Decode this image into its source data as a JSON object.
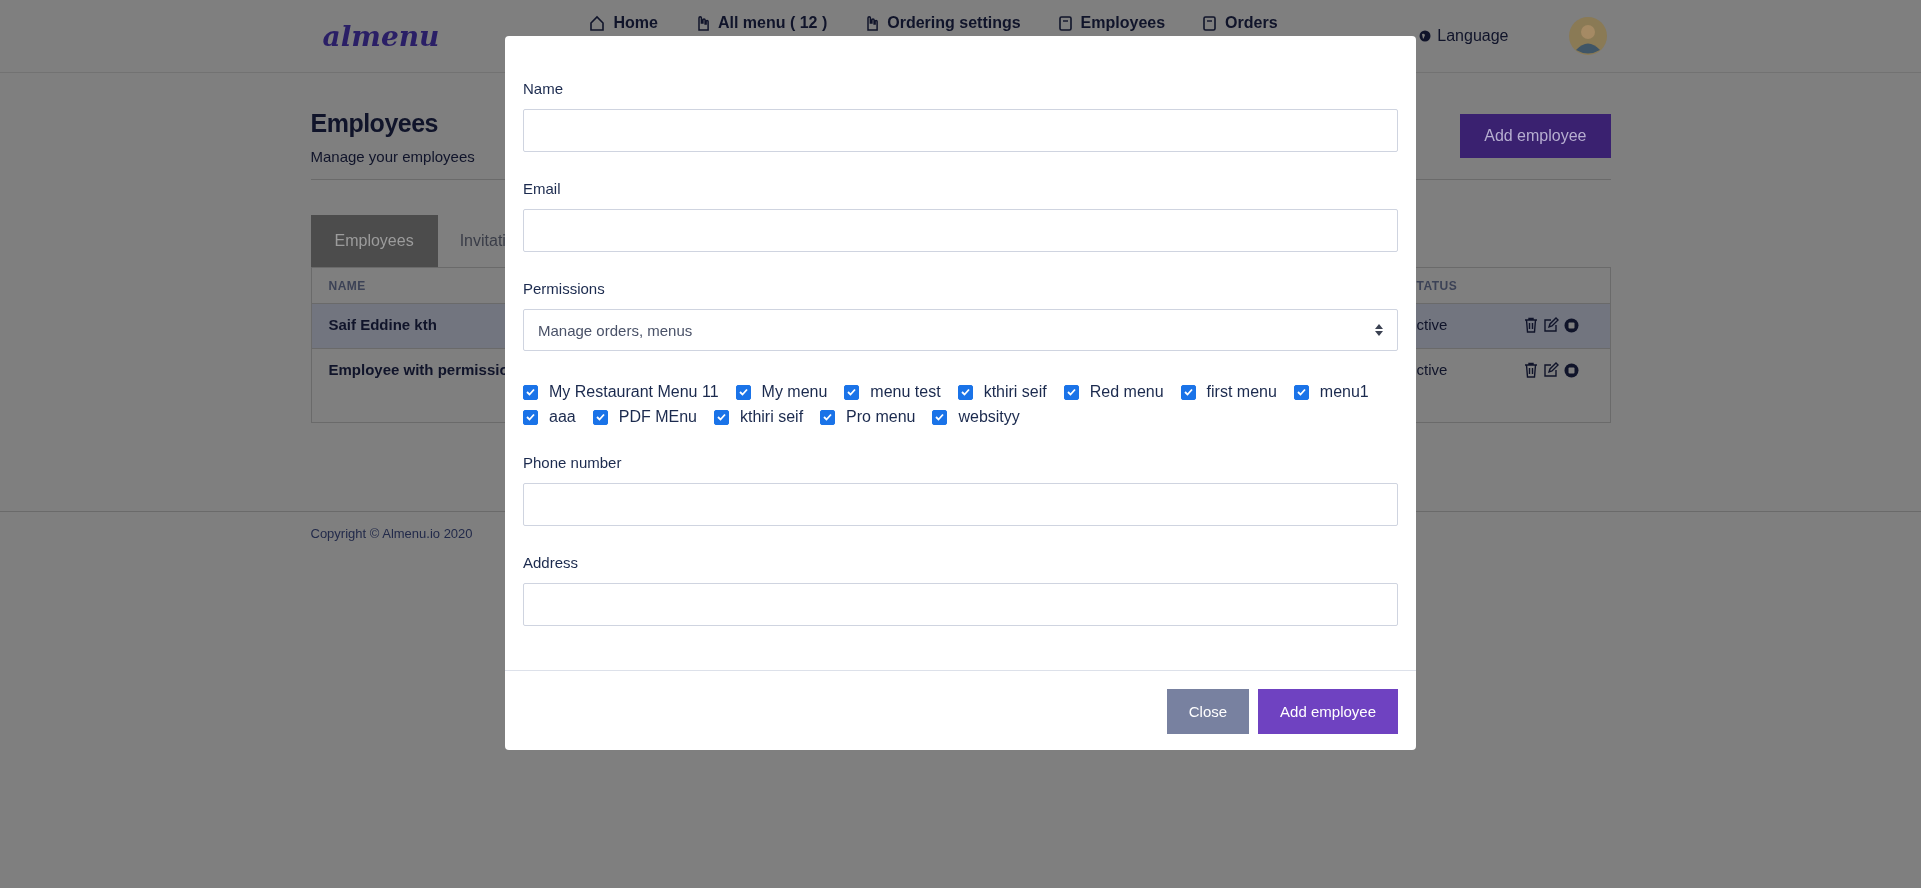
{
  "header": {
    "logo": "almenu",
    "nav": [
      {
        "label": "Home"
      },
      {
        "label": "All menu ( 12 )"
      },
      {
        "label": "Ordering settings"
      },
      {
        "label": "Employees"
      },
      {
        "label": "Orders"
      }
    ],
    "language": "Language"
  },
  "page": {
    "title": "Employees",
    "subtitle": "Manage your employees",
    "add_button": "Add employee"
  },
  "tabs": [
    {
      "label": "Employees",
      "selected": true
    },
    {
      "label": "Invitati",
      "selected": false
    }
  ],
  "table": {
    "columns": [
      "NAME",
      "TATUS"
    ],
    "rows": [
      {
        "name": "Saif Eddine kth",
        "status": "ctive",
        "highlighted": true
      },
      {
        "name": "Employee with permissio",
        "status": "ctive",
        "highlighted": false
      }
    ]
  },
  "footer": {
    "copyright": "Copyright © Almenu.io 2020"
  },
  "modal": {
    "fields": [
      {
        "kind": "input",
        "label": "Name"
      },
      {
        "kind": "input",
        "label": "Email"
      },
      {
        "kind": "select",
        "label": "Permissions",
        "value": "Manage orders, menus"
      },
      {
        "kind": "checks",
        "options": [
          {
            "label": "My Restaurant Menu 11",
            "checked": true
          },
          {
            "label": "My menu",
            "checked": true
          },
          {
            "label": "menu test",
            "checked": true
          },
          {
            "label": "kthiri seif",
            "checked": true
          },
          {
            "label": "Red menu",
            "checked": true
          },
          {
            "label": "first menu",
            "checked": true
          },
          {
            "label": "menu1",
            "checked": true
          },
          {
            "label": "aaa",
            "checked": true
          },
          {
            "label": "PDF MEnu",
            "checked": true
          },
          {
            "label": "kthiri seif",
            "checked": true
          },
          {
            "label": "Pro menu",
            "checked": true
          },
          {
            "label": "websityy",
            "checked": true
          }
        ]
      },
      {
        "kind": "input",
        "label": "Phone number"
      },
      {
        "kind": "input",
        "label": "Address"
      }
    ],
    "buttons": [
      {
        "kind": "secondary",
        "label": "Close"
      },
      {
        "kind": "primary",
        "label": "Add employee"
      }
    ]
  }
}
